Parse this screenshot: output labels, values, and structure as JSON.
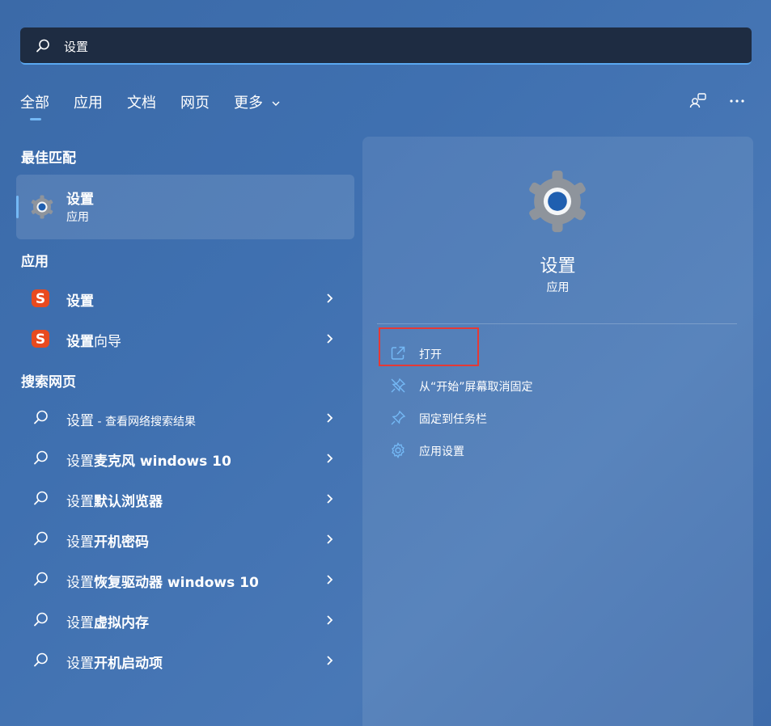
{
  "search": {
    "value": "设置"
  },
  "tabs": [
    {
      "label": "全部"
    },
    {
      "label": "应用"
    },
    {
      "label": "文档"
    },
    {
      "label": "网页"
    },
    {
      "label": "更多"
    }
  ],
  "best_match": {
    "heading": "最佳匹配",
    "title": "设置",
    "subtitle": "应用"
  },
  "apps": {
    "heading": "应用",
    "items": [
      {
        "bold": "设置",
        "rest": ""
      },
      {
        "bold": "设置",
        "rest": "向导"
      }
    ]
  },
  "web": {
    "heading": "搜索网页",
    "items": [
      {
        "prefix": "设置",
        "bold": "",
        "sub": " - 查看网络搜索结果"
      },
      {
        "prefix": "设置",
        "bold": "麦克风 windows 10",
        "sub": ""
      },
      {
        "prefix": "设置",
        "bold": "默认浏览器",
        "sub": ""
      },
      {
        "prefix": "设置",
        "bold": "开机密码",
        "sub": ""
      },
      {
        "prefix": "设置",
        "bold": "恢复驱动器 windows 10",
        "sub": ""
      },
      {
        "prefix": "设置",
        "bold": "虚拟内存",
        "sub": ""
      },
      {
        "prefix": "设置",
        "bold": "开机启动项",
        "sub": ""
      }
    ]
  },
  "detail": {
    "title": "设置",
    "subtitle": "应用",
    "actions": [
      {
        "label": "打开",
        "icon": "open-icon"
      },
      {
        "label": "从“开始”屏幕取消固定",
        "icon": "unpin-icon"
      },
      {
        "label": "固定到任务栏",
        "icon": "pin-icon"
      },
      {
        "label": "应用设置",
        "icon": "gear-icon"
      }
    ]
  },
  "colors": {
    "accent": "#74b8f5",
    "highlight": "#e53935",
    "sogou": "#e84a1f"
  }
}
